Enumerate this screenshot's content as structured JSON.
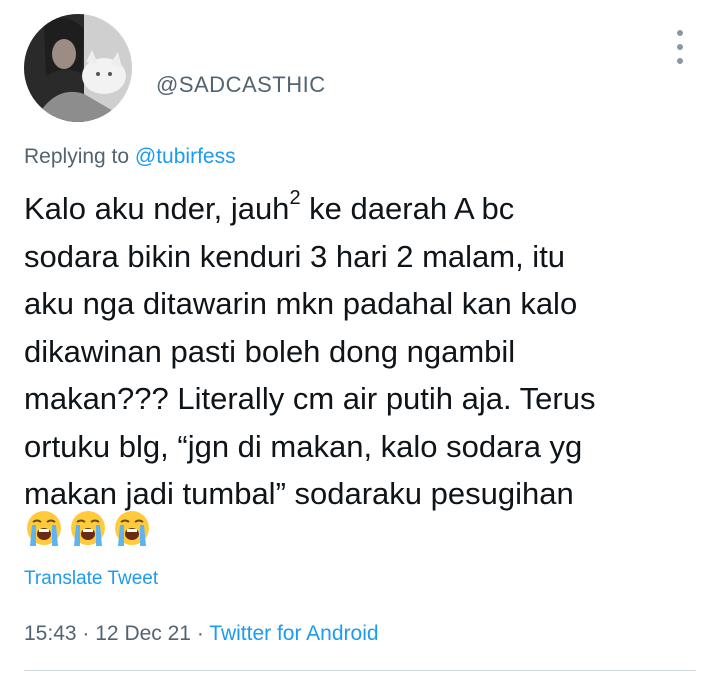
{
  "tweet": {
    "handle": "@SADCASTHIC",
    "replying_prefix": "Replying to",
    "replying_to": "@tubirfess",
    "lines": {
      "l1a": "Kalo aku nder, jauh",
      "l1sup": "2",
      "l1b": " ke daerah A bc",
      "l2": "sodara bikin kenduri 3 hari 2 malam, itu",
      "l3": "aku nga ditawarin mkn padahal kan kalo",
      "l4": "dikawinan pasti boleh dong ngambil",
      "l5": "makan??? Literally cm air putih aja. Terus",
      "l6": "ortuku blg, “jgn di makan, kalo sodara yg",
      "l7": "makan jadi tumbal” sodaraku pesugihan"
    },
    "emojis": [
      "loudly-crying-face-icon",
      "loudly-crying-face-icon",
      "loudly-crying-face-icon"
    ],
    "translate_label": "Translate Tweet",
    "time": "15:43",
    "separator": "·",
    "date": "12 Dec 21",
    "source": "Twitter for Android"
  }
}
